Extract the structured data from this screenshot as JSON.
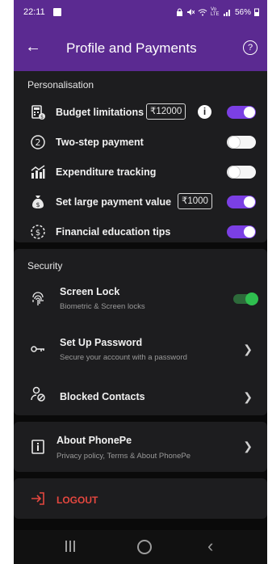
{
  "status_bar": {
    "time": "22:11",
    "icons": [
      "notification-box-icon",
      "lock-icon",
      "mute-icon",
      "wifi-icon",
      "signal-icon",
      "battery-icon"
    ],
    "battery": "56%",
    "network": "Vo LTE"
  },
  "header": {
    "title": "Profile and Payments",
    "back_icon": "arrow-left-icon",
    "help_icon": "help-circle-icon"
  },
  "personalisation": {
    "title": "Personalisation",
    "items": [
      {
        "label": "Budget limitations",
        "chip": "₹12000",
        "toggle": "on",
        "icon": "budget-calculator-icon"
      },
      {
        "label": "Two-step payment",
        "toggle": "off",
        "icon": "two-step-icon"
      },
      {
        "label": "Expenditure tracking",
        "toggle": "off",
        "icon": "chart-icon"
      },
      {
        "label": "Set large payment value",
        "chip": "₹1000",
        "toggle": "on",
        "icon": "money-bag-icon"
      },
      {
        "label": "Financial education tips",
        "toggle": "on",
        "icon": "rupee-tip-icon"
      }
    ]
  },
  "security": {
    "title": "Security",
    "items": [
      {
        "label": "Screen Lock",
        "sub": "Biometric & Screen locks",
        "icon": "fingerprint-icon",
        "toggle": "on"
      },
      {
        "label": "Set Up Password",
        "sub": "Secure your account with a password",
        "icon": "key-icon"
      },
      {
        "label": "Blocked Contacts",
        "icon": "blocked-user-icon"
      }
    ]
  },
  "about": {
    "label": "About PhonePe",
    "sub": "Privacy policy, Terms & About PhonePe",
    "icon": "info-box-icon"
  },
  "logout": {
    "label": "LOGOUT",
    "icon": "logout-icon"
  },
  "colors": {
    "header": "#5b2a91",
    "accent": "#7b3fe4",
    "card": "#1d1d1f",
    "logout": "#e5473f",
    "lock_toggle": "#2fbf4f"
  }
}
